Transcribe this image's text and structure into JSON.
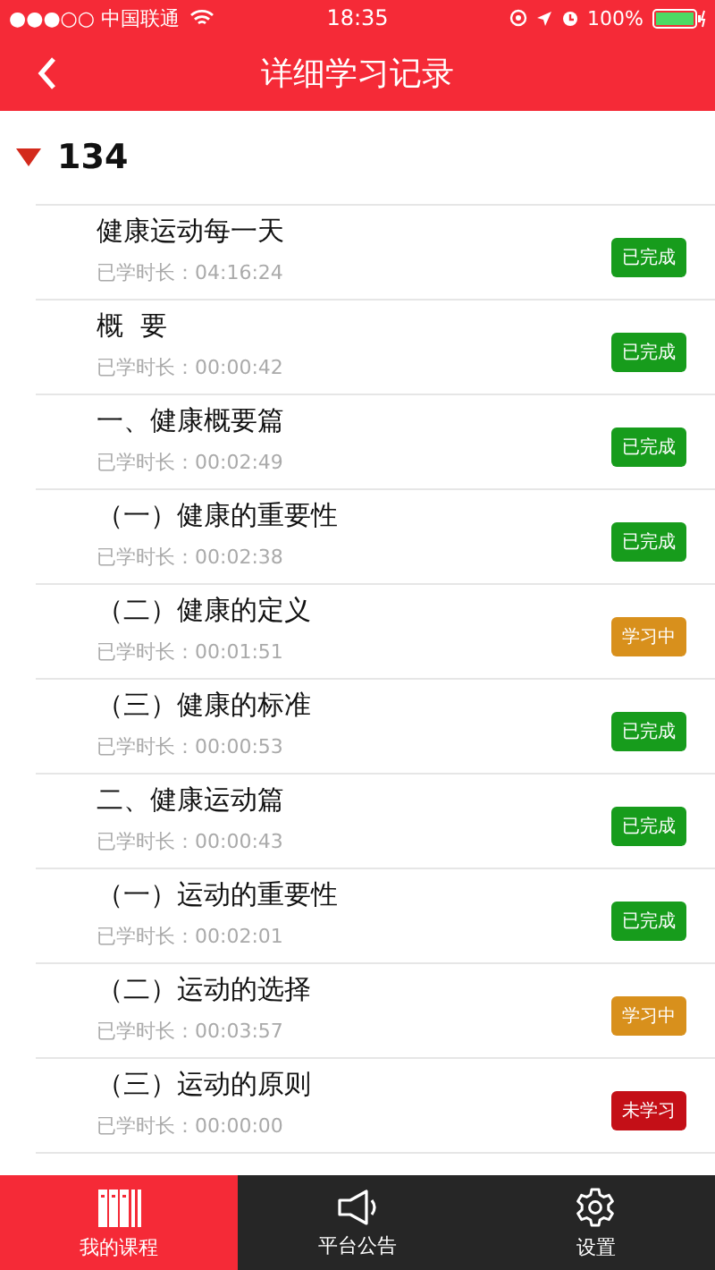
{
  "status_bar": {
    "carrier": "●●●○○ 中国联通",
    "time": "18:35",
    "battery": "100%"
  },
  "nav": {
    "title": "详细学习记录"
  },
  "section": {
    "title": "134",
    "expanded": true
  },
  "lessons": [
    {
      "title": "健康运动每一天",
      "duration": "已学时长：04:16:24",
      "status": "已完成",
      "kind": "done"
    },
    {
      "title": "概  要",
      "duration": "已学时长：00:00:42",
      "status": "已完成",
      "kind": "done"
    },
    {
      "title": "一、健康概要篇",
      "duration": "已学时长：00:02:49",
      "status": "已完成",
      "kind": "done"
    },
    {
      "title": "（一）健康的重要性",
      "duration": "已学时长：00:02:38",
      "status": "已完成",
      "kind": "done"
    },
    {
      "title": "（二）健康的定义",
      "duration": "已学时长：00:01:51",
      "status": "学习中",
      "kind": "learning"
    },
    {
      "title": "（三）健康的标准",
      "duration": "已学时长：00:00:53",
      "status": "已完成",
      "kind": "done"
    },
    {
      "title": "二、健康运动篇",
      "duration": "已学时长：00:00:43",
      "status": "已完成",
      "kind": "done"
    },
    {
      "title": "（一）运动的重要性",
      "duration": "已学时长：00:02:01",
      "status": "已完成",
      "kind": "done"
    },
    {
      "title": "（二）运动的选择",
      "duration": "已学时长：00:03:57",
      "status": "学习中",
      "kind": "learning"
    },
    {
      "title": "（三）运动的原则",
      "duration": "已学时长：00:00:00",
      "status": "未学习",
      "kind": "not_started"
    }
  ],
  "tabs": [
    {
      "label": "我的课程",
      "kind": "courses",
      "selected": true
    },
    {
      "label": "平台公告",
      "kind": "notices",
      "selected": false
    },
    {
      "label": "设置",
      "kind": "settings",
      "selected": false
    }
  ]
}
